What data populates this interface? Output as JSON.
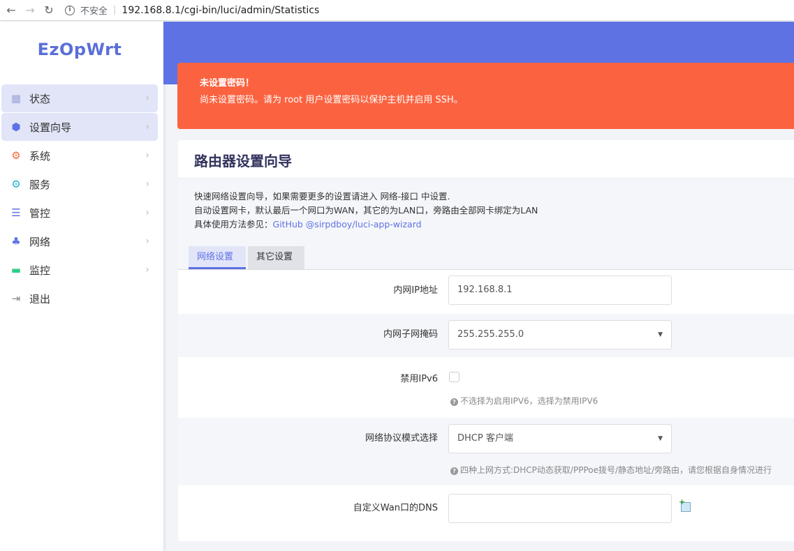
{
  "browser": {
    "back": "←",
    "forward": "→",
    "reload": "↻",
    "info": "i",
    "security": "不安全",
    "url": "192.168.8.1/cgi-bin/luci/admin/Statistics"
  },
  "logo": "EzOpWrt",
  "menu": [
    {
      "label": "状态",
      "icon": "grid-icon",
      "glyph": "▦",
      "color": "#9aa5d8"
    },
    {
      "label": "设置向导",
      "icon": "cube-icon",
      "glyph": "⬢",
      "color": "#5e72e4"
    },
    {
      "label": "系统",
      "icon": "gear-icon",
      "glyph": "⚙",
      "color": "#f5683a"
    },
    {
      "label": "服务",
      "icon": "cogs-icon",
      "glyph": "⚙",
      "color": "#23b5d3"
    },
    {
      "label": "管控",
      "icon": "sliders-icon",
      "glyph": "☰",
      "color": "#5e72e4"
    },
    {
      "label": "网络",
      "icon": "sitemap-icon",
      "glyph": "⊥",
      "color": "#5e72e4"
    },
    {
      "label": "监控",
      "icon": "monitor-icon",
      "glyph": "▭",
      "color": "#2dce89"
    },
    {
      "label": "退出",
      "icon": "logout-icon",
      "glyph": "⇥",
      "color": "#888"
    }
  ],
  "alert": {
    "title": "未设置密码！",
    "text": "尚未设置密码。请为 root 用户设置密码以保护主机并启用 SSH。"
  },
  "card": {
    "title": "路由器设置向导",
    "desc_line1": "快速网络设置向导，如果需要更多的设置请进入 网络-接口 中设置.",
    "desc_line2": "自动设置网卡，默认最后一个网口为WAN，其它的为LAN口，旁路由全部网卡绑定为LAN",
    "desc_line3_prefix": "具体使用方法参见：",
    "desc_link": "GitHub @sirpdboy/luci-app-wizard"
  },
  "tabs": [
    "网络设置",
    "其它设置"
  ],
  "form": {
    "lan_ip_label": "内网IP地址",
    "lan_ip_value": "192.168.8.1",
    "netmask_label": "内网子网掩码",
    "netmask_value": "255.255.255.0",
    "ipv6_label": "禁用IPv6",
    "ipv6_hint": "不选择为启用IPV6，选择为禁用IPV6",
    "proto_label": "网络协议模式选择",
    "proto_value": "DHCP 客户端",
    "proto_hint": "四种上网方式:DHCP动态获取/PPPoe拨号/静态地址/旁路由，请您根据自身情况进行",
    "dns_label": "自定义Wan口的DNS",
    "dns_value": ""
  }
}
